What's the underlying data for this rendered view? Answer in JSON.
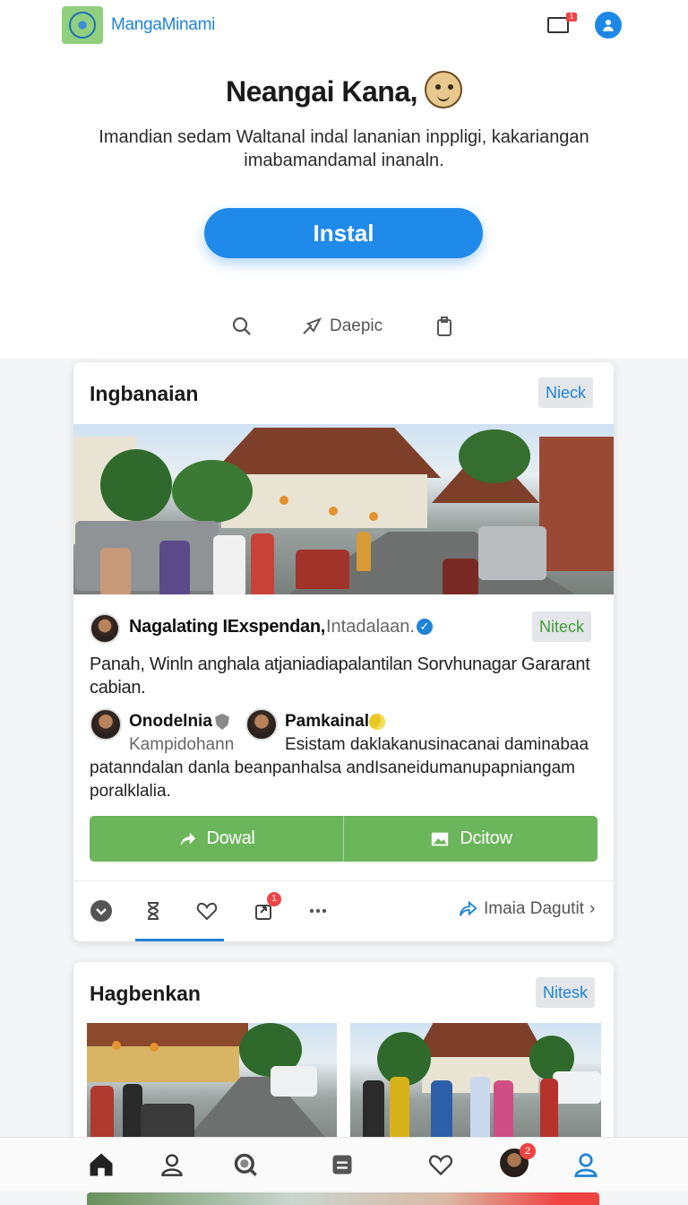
{
  "header": {
    "app_name": "MangaMinami",
    "notification_count": "1"
  },
  "hero": {
    "title": "Neangai Kana,",
    "subtitle": "Imandian sedam Waltanal indal lananian inppligi, kakariangan imabamandamal inanaln.",
    "install_label": "Instal"
  },
  "quick_actions": {
    "share_label": "Daepic"
  },
  "card1": {
    "title": "Ingbanaian",
    "tag": "Nieck",
    "author": {
      "name": "Nagalating IExspendan,",
      "meta": "Intadalaan.",
      "tag": "Niteck"
    },
    "post_text": "Panah, Winln anghala atjaniadiapalantilan Sorvhunagar Gararant cabian.",
    "comments": [
      {
        "name": "Onodelnia",
        "sub": "Kampidohann"
      },
      {
        "name": "Pamkainal",
        "text_a": "Esistam daklakanusinacanai daminabaa"
      }
    ],
    "comment_continuation": [
      "patanndalan danla beanpanhalsa andIsaneidumanupapniangam",
      "poralklalia."
    ],
    "actions": {
      "download": "Dowal",
      "edit": "Dcitow"
    },
    "footer": {
      "badge": "1",
      "more_label": "Imaia Dagutit"
    }
  },
  "card2": {
    "title": "Hagbenkan",
    "tag": "Nitesk"
  },
  "bottom_nav": {
    "badge": "2"
  },
  "colors": {
    "accent": "#1f8ae9",
    "action_green": "#6bb65a",
    "badge_red": "#e44444"
  }
}
